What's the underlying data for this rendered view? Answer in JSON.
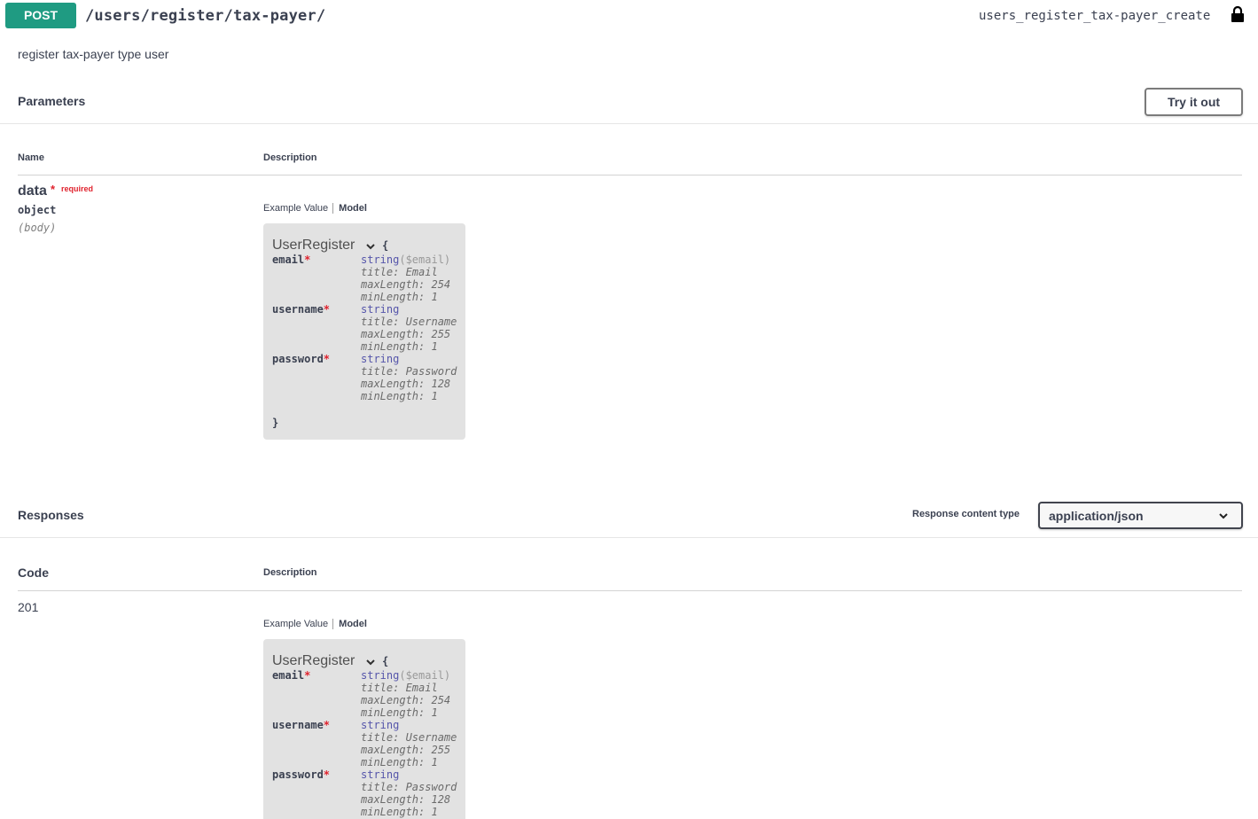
{
  "operation": {
    "method": "POST",
    "path": "/users/register/tax-payer/",
    "operation_id": "users_register_tax-payer_create",
    "summary": "register tax-payer type user",
    "lock_icon": "lock-icon"
  },
  "parameters": {
    "title": "Parameters",
    "try_it_out_label": "Try it out",
    "col_name": "Name",
    "col_description": "Description",
    "param": {
      "name": "data",
      "required_star": "*",
      "required_label": "required",
      "type": "object",
      "in": "(body)"
    },
    "tabs": {
      "example": "Example Value",
      "model": "Model"
    }
  },
  "model": {
    "name": "UserRegister",
    "open_brace": "{",
    "close_brace": "}",
    "properties": [
      {
        "name": "email",
        "star": "*",
        "type": "string",
        "format": "($email)",
        "title": "title: Email",
        "max": "maxLength: 254",
        "min": "minLength: 1"
      },
      {
        "name": "username",
        "star": "*",
        "type": "string",
        "format": "",
        "title": "title: Username",
        "max": "maxLength: 255",
        "min": "minLength: 1"
      },
      {
        "name": "password",
        "star": "*",
        "type": "string",
        "format": "",
        "title": "title: Password",
        "max": "maxLength: 128",
        "min": "minLength: 1"
      }
    ]
  },
  "responses": {
    "title": "Responses",
    "content_type_label": "Response content type",
    "content_type_value": "application/json",
    "col_code": "Code",
    "col_description": "Description",
    "code": "201",
    "tabs": {
      "example": "Example Value",
      "model": "Model"
    }
  },
  "colors": {
    "post": "#1f9b82",
    "required": "#e0232e",
    "type": "#5555aa"
  }
}
